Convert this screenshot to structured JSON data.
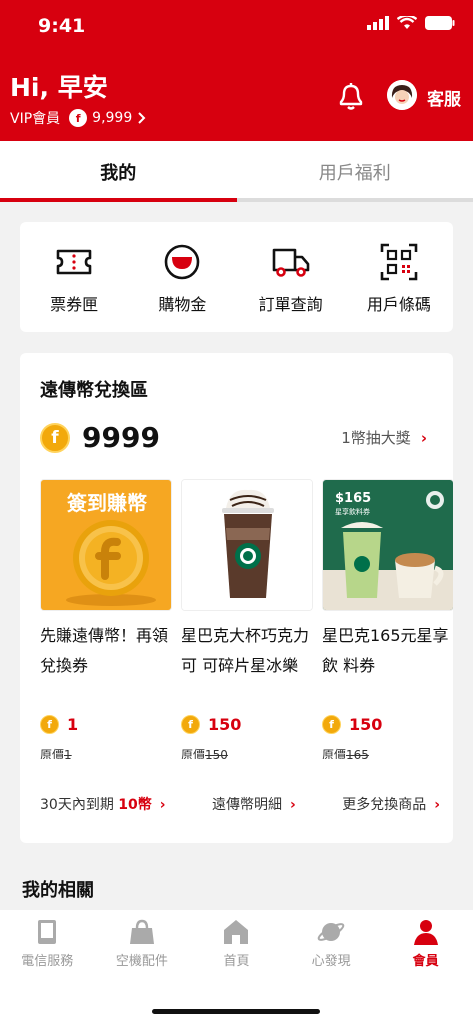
{
  "status_bar": {
    "time": "9:41"
  },
  "header": {
    "greeting": "Hi, 早安",
    "vip_label": "VIP會員",
    "coin_symbol": "f",
    "coin_balance": "9,999",
    "service_label": "客服",
    "icons": [
      "bell-icon",
      "avatar",
      "chevron-right-icon"
    ]
  },
  "tabs": [
    {
      "label": "我的",
      "active": true
    },
    {
      "label": "用戶福利",
      "active": false
    }
  ],
  "quick_actions": [
    {
      "label": "票券匣",
      "icon": "ticket-icon"
    },
    {
      "label": "購物金",
      "icon": "shopping-credit-icon"
    },
    {
      "label": "訂單查詢",
      "icon": "truck-icon"
    },
    {
      "label": "用戶條碼",
      "icon": "qr-code-icon"
    }
  ],
  "exchange": {
    "title": "遠傳幣兌換區",
    "coin_symbol": "f",
    "balance": "9999",
    "lottery_link": "1幣抽大獎",
    "products": [
      {
        "name": "先賺遠傳幣！再領兌換券",
        "banner": "簽到賺幣",
        "price": "1",
        "original_label": "原價",
        "original_value": "1"
      },
      {
        "name": "星巴克大杯巧克力可 可碎片星冰樂",
        "price": "150",
        "original_label": "原價",
        "original_value": "150"
      },
      {
        "name": "星巴克165元星享飲 料券",
        "image_price_tag": "$165",
        "image_caption": "星享飲料券",
        "price": "150",
        "original_label": "原價",
        "original_value": "165"
      }
    ],
    "links": {
      "expiring_prefix": "30天內到期",
      "expiring_count": "10幣",
      "details": "遠傳幣明細",
      "more": "更多兌換商品"
    }
  },
  "related_title": "我的相關",
  "bottom_nav": [
    {
      "label": "電信服務",
      "icon": "phone-icon",
      "active": false
    },
    {
      "label": "空機配件",
      "icon": "shopping-bag-icon",
      "active": false
    },
    {
      "label": "首頁",
      "icon": "home-icon",
      "active": false
    },
    {
      "label": "心發現",
      "icon": "planet-icon",
      "active": false
    },
    {
      "label": "會員",
      "icon": "member-icon",
      "active": true
    }
  ],
  "colors": {
    "brand": "#d7000f",
    "coin": "#f2a90c"
  }
}
